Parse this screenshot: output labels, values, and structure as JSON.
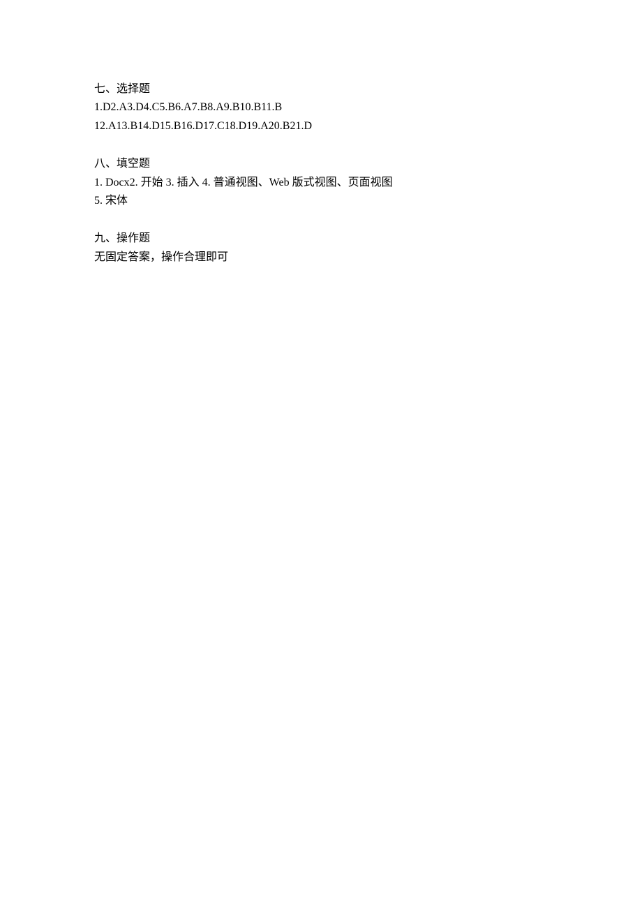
{
  "sections": [
    {
      "title": "七、选择题",
      "lines": [
        "1.D2.A3.D4.C5.B6.A7.B8.A9.B10.B11.B",
        "12.A13.B14.D15.B16.D17.C18.D19.A20.B21.D"
      ]
    },
    {
      "title": "八、填空题",
      "lines": [
        "1. Docx2. 开始 3. 插入 4. 普通视图、Web 版式视图、页面视图",
        "5. 宋体"
      ]
    },
    {
      "title": "九、操作题",
      "lines": [
        "无固定答案，操作合理即可"
      ]
    }
  ]
}
